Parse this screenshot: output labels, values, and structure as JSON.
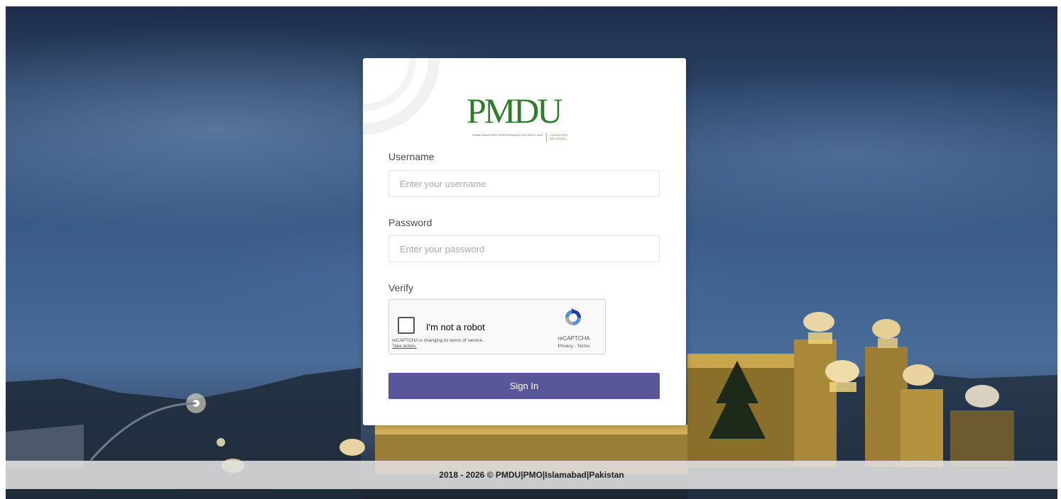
{
  "logo": {
    "wordmark": "PMDU",
    "sub_left": "PRIME MINISTER'S PERFORMANCE DELIVERY UNIT",
    "sub_right": "CONSISTENT DELIVERED"
  },
  "form": {
    "username_label": "Username",
    "username_placeholder": "Enter your username",
    "username_value": "",
    "password_label": "Password",
    "password_placeholder": "Enter your password",
    "password_value": "",
    "verify_label": "Verify",
    "submit_label": "Sign In"
  },
  "recaptcha": {
    "checkbox_label": "I'm not a robot",
    "checked": false,
    "notice": "reCAPTCHA is changing its terms of service.",
    "notice_link": "Take action.",
    "brand": "reCAPTCHA",
    "privacy": "Privacy",
    "terms_sep": " - ",
    "terms": "Terms"
  },
  "footer": {
    "years": "2018 - 2026 © ",
    "org": "PMDU",
    "office": "PMO",
    "city": "Islamabad",
    "country": "Pakistan",
    "separator": "|"
  },
  "colors": {
    "button": "#5a569a",
    "logo_green": "#2f7d2a",
    "logo_gold": "#8a7a43"
  }
}
